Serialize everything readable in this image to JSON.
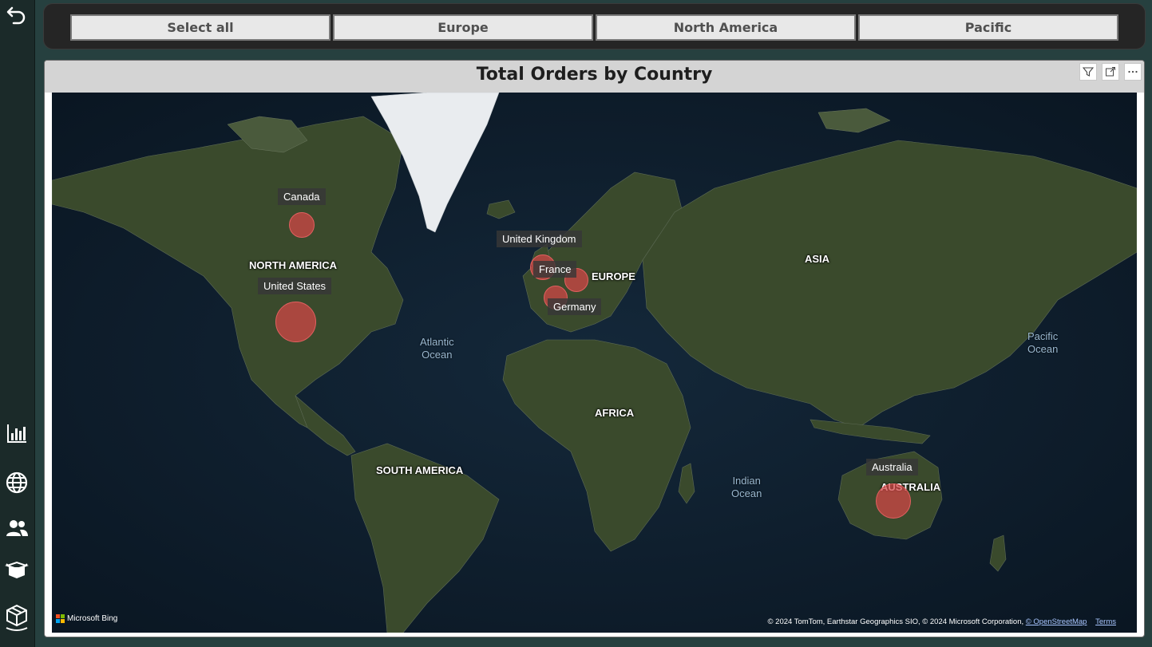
{
  "slicer": {
    "buttons": [
      {
        "label": "Select all"
      },
      {
        "label": "Europe"
      },
      {
        "label": "North America"
      },
      {
        "label": "Pacific"
      }
    ]
  },
  "nav": {
    "icons": [
      "back-arrow-icon",
      "bar-chart-icon",
      "globe-icon",
      "people-icon",
      "box-open-icon",
      "package-icon"
    ]
  },
  "visual": {
    "title": "Total Orders by Country",
    "header_icons": [
      "filter-icon",
      "focus-mode-icon",
      "more-options-icon"
    ]
  },
  "map": {
    "region_labels": {
      "north_america": "NORTH AMERICA",
      "south_america": "SOUTH AMERICA",
      "europe": "EUROPE",
      "asia": "ASIA",
      "africa": "AFRICA",
      "australia": "AUSTRALIA"
    },
    "ocean_labels": {
      "atlantic": "Atlantic\nOcean",
      "indian": "Indian\nOcean",
      "pacific": "Pacific\nOcean"
    },
    "countries": [
      {
        "name": "Canada",
        "lat": 56.1,
        "lon": -106.3
      },
      {
        "name": "United States",
        "lat": 37.1,
        "lon": -95.7
      },
      {
        "name": "United Kingdom",
        "lat": 55.4,
        "lon": -3.4
      },
      {
        "name": "France",
        "lat": 46.2,
        "lon": 2.2
      },
      {
        "name": "Germany",
        "lat": 51.2,
        "lon": 10.4
      },
      {
        "name": "Australia",
        "lat": -25.3,
        "lon": 133.8
      }
    ],
    "bing_logo_text": "Microsoft Bing",
    "attribution": {
      "text": "© 2024 TomTom, Earthstar Geographics SIO, © 2024 Microsoft Corporation,",
      "link": "© OpenStreetMap",
      "terms": "Terms"
    }
  },
  "colors": {
    "background": "#26403f",
    "sidebar": "#1b2a29",
    "bubble_fill": "#d64646",
    "slicer_bg": "#e8e8e8",
    "title_bar": "#d4d4d4"
  }
}
